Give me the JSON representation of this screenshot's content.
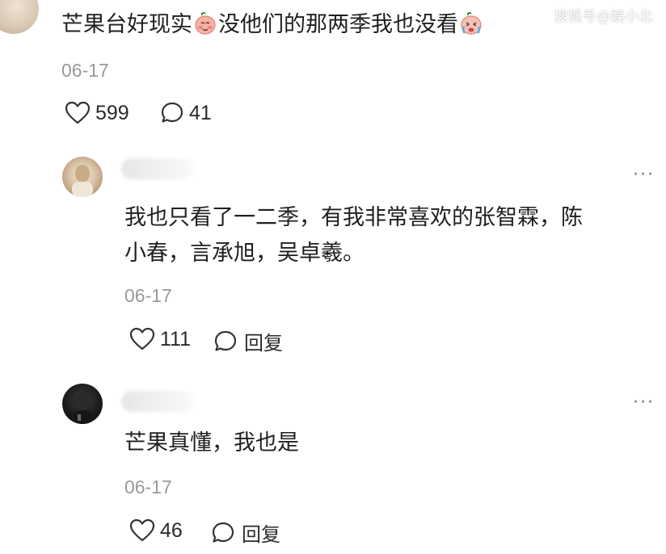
{
  "watermark": "搜狐号@娱小北",
  "top_comment": {
    "text_part1": "芒果台好现实",
    "text_part2": "没他们的那两季我也没看",
    "emoji_1": "blushing-face-emoji",
    "emoji_2": "crying-face-emoji",
    "date": "06-17",
    "likes": "599",
    "comments": "41"
  },
  "replies": [
    {
      "text_line1": "我也只看了一二季，有我非常喜欢的张智霖，陈",
      "text_line2": "小春，言承旭，吴卓羲。",
      "date": "06-17",
      "likes": "111",
      "reply_label": "回复",
      "more": "···"
    },
    {
      "text_line1": "芒果真懂，我也是",
      "date": "06-17",
      "likes": "46",
      "reply_label": "回复",
      "more": "···"
    }
  ],
  "icons": {
    "like": "heart-outline-icon",
    "comment": "speech-bubble-icon",
    "more": "more-dots-icon"
  },
  "colors": {
    "text": "#1f1f1f",
    "muted": "#9a9a9a",
    "background": "#ffffff"
  }
}
